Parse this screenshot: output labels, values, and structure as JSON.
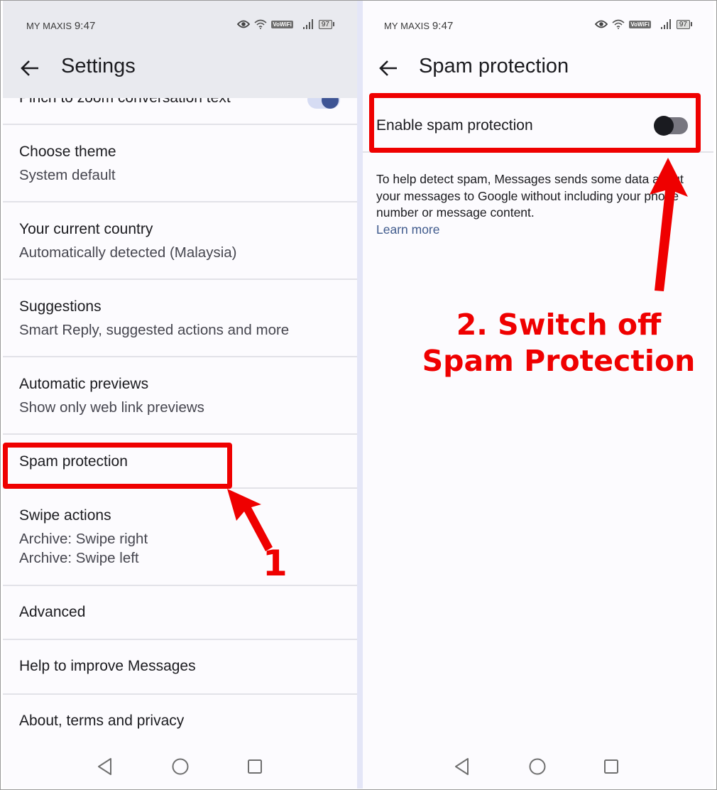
{
  "colors": {
    "annotation_red": "#ef0000",
    "toggle_on_knob": "#3e5494",
    "toggle_off_knob": "#1a1b20",
    "link": "#3f5a8c"
  },
  "left_screen": {
    "status_bar": {
      "carrier": "MY MAXIS",
      "time": "9:47",
      "icons": [
        "eye-icon",
        "wifi-icon",
        "vowifi-badge",
        "signal-icon",
        "battery-icon"
      ],
      "vowifi": "VoWiFi",
      "battery": "97"
    },
    "header": {
      "back_icon": "arrow-back-icon",
      "title": "Settings"
    },
    "settings": [
      {
        "title": "Pinch to zoom conversation text",
        "toggle": "on"
      },
      {
        "title": "Choose theme",
        "subtitle": "System default"
      },
      {
        "title": "Your current country",
        "subtitle": "Automatically detected (Malaysia)"
      },
      {
        "title": "Suggestions",
        "subtitle": "Smart Reply, suggested actions and more"
      },
      {
        "title": "Automatic previews",
        "subtitle": "Show only web link previews"
      },
      {
        "title": "Spam protection"
      },
      {
        "title": "Swipe actions",
        "subtitle": "Archive: Swipe right",
        "subtitle2": "Archive: Swipe left"
      },
      {
        "title": "Advanced"
      },
      {
        "title": "Help to improve Messages"
      },
      {
        "title": "About, terms and privacy"
      }
    ],
    "nav_bar": [
      "back-nav-icon",
      "home-nav-icon",
      "recents-nav-icon"
    ]
  },
  "right_screen": {
    "status_bar": {
      "carrier": "MY MAXIS",
      "time": "9:47",
      "vowifi": "VoWiFi",
      "battery": "97"
    },
    "header": {
      "back_icon": "arrow-back-icon",
      "title": "Spam protection"
    },
    "enable_row": {
      "label": "Enable spam protection",
      "toggle": "off"
    },
    "description": "To help detect spam, Messages sends some data about your messages to Google without including your phone number or message content.",
    "learn_more": "Learn more",
    "nav_bar": [
      "back-nav-icon",
      "home-nav-icon",
      "recents-nav-icon"
    ]
  },
  "annotations": {
    "step1_label": "1",
    "step2_line1": "2. Switch off",
    "step2_line2": "Spam Protection"
  }
}
